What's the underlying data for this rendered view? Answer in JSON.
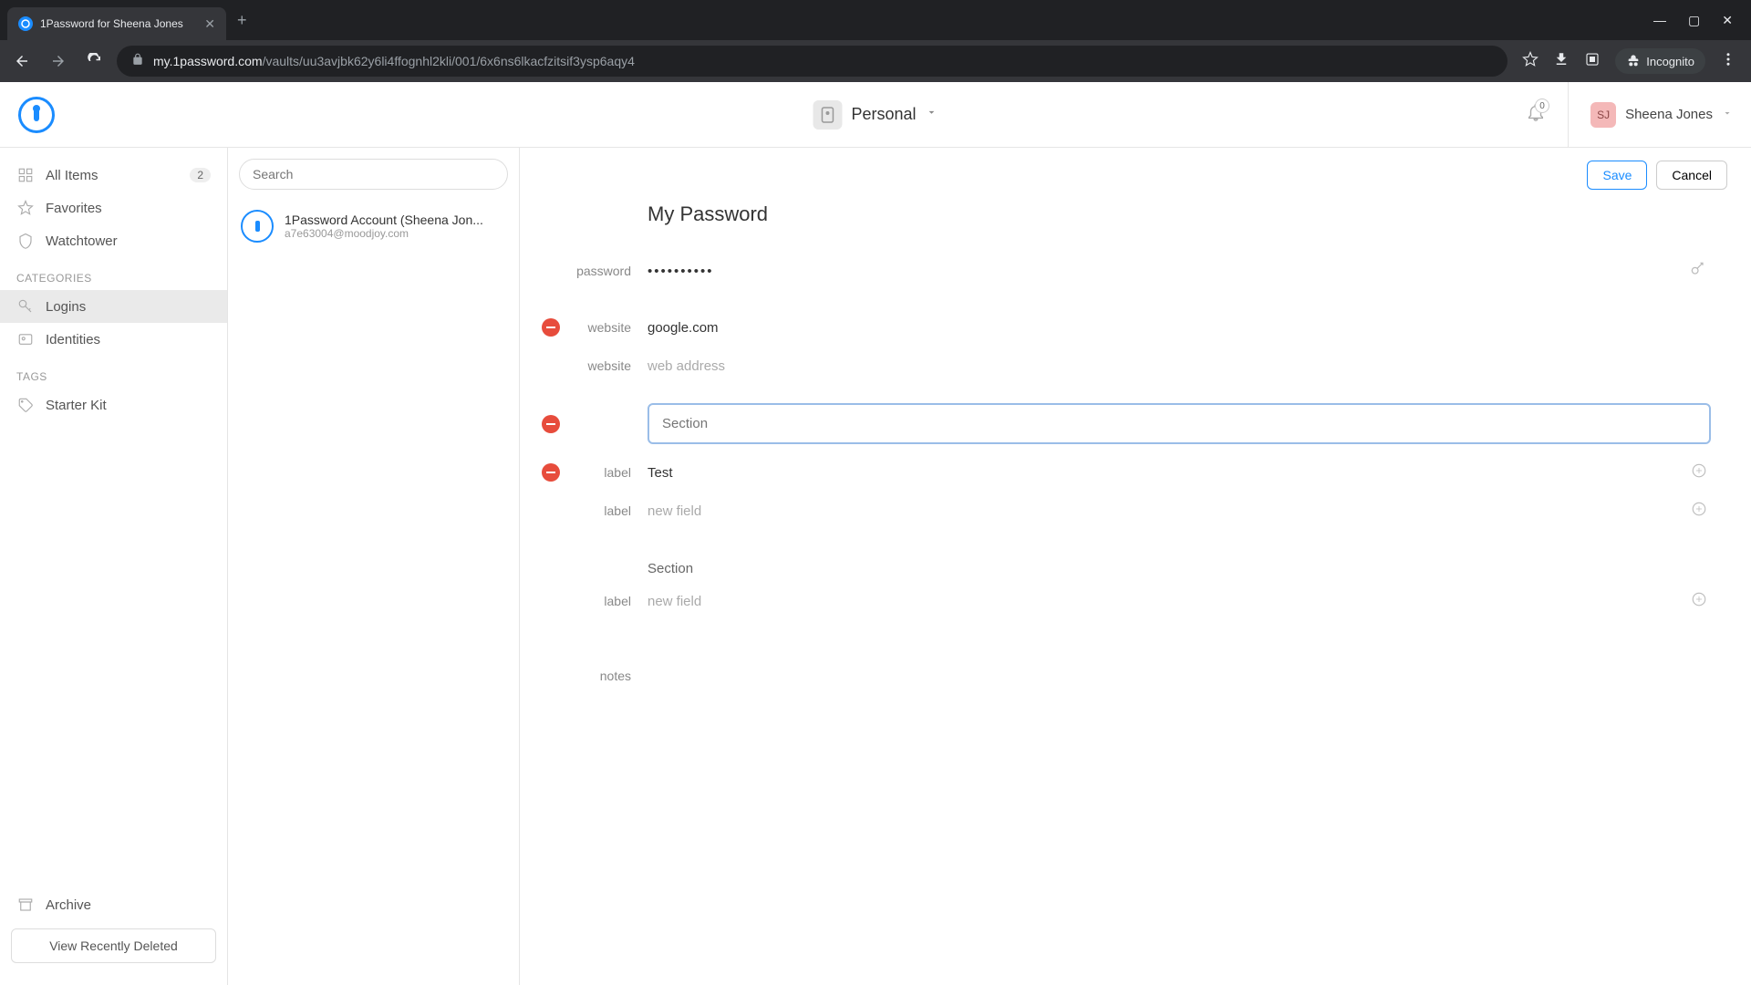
{
  "browser": {
    "tab_title": "1Password for Sheena Jones",
    "url_domain": "my.1password.com",
    "url_path": "/vaults/uu3avjbk62y6li4ffognhl2kli/001/6x6ns6lkacfzitsif3ysp6aqy4",
    "incognito_label": "Incognito"
  },
  "header": {
    "vault_name": "Personal",
    "notif_count": "0",
    "user_initials": "SJ",
    "user_name": "Sheena Jones"
  },
  "sidebar": {
    "all_items": "All Items",
    "all_items_count": "2",
    "favorites": "Favorites",
    "watchtower": "Watchtower",
    "categories_label": "CATEGORIES",
    "logins": "Logins",
    "identities": "Identities",
    "tags_label": "TAGS",
    "starter_kit": "Starter Kit",
    "archive": "Archive",
    "recently_deleted": "View Recently Deleted"
  },
  "list": {
    "search_placeholder": "Search",
    "entry_title": "1Password Account (Sheena Jon...",
    "entry_sub": "a7e63004@moodjoy.com"
  },
  "detail": {
    "save": "Save",
    "cancel": "Cancel",
    "title": "My Password",
    "password_label": "password",
    "password_value": "••••••••••",
    "website_label": "website",
    "website_value": "google.com",
    "website_placeholder": "web address",
    "section_placeholder": "Section",
    "label_label": "label",
    "test_value": "Test",
    "new_field_placeholder": "new field",
    "section_static": "Section",
    "notes_label": "notes"
  }
}
